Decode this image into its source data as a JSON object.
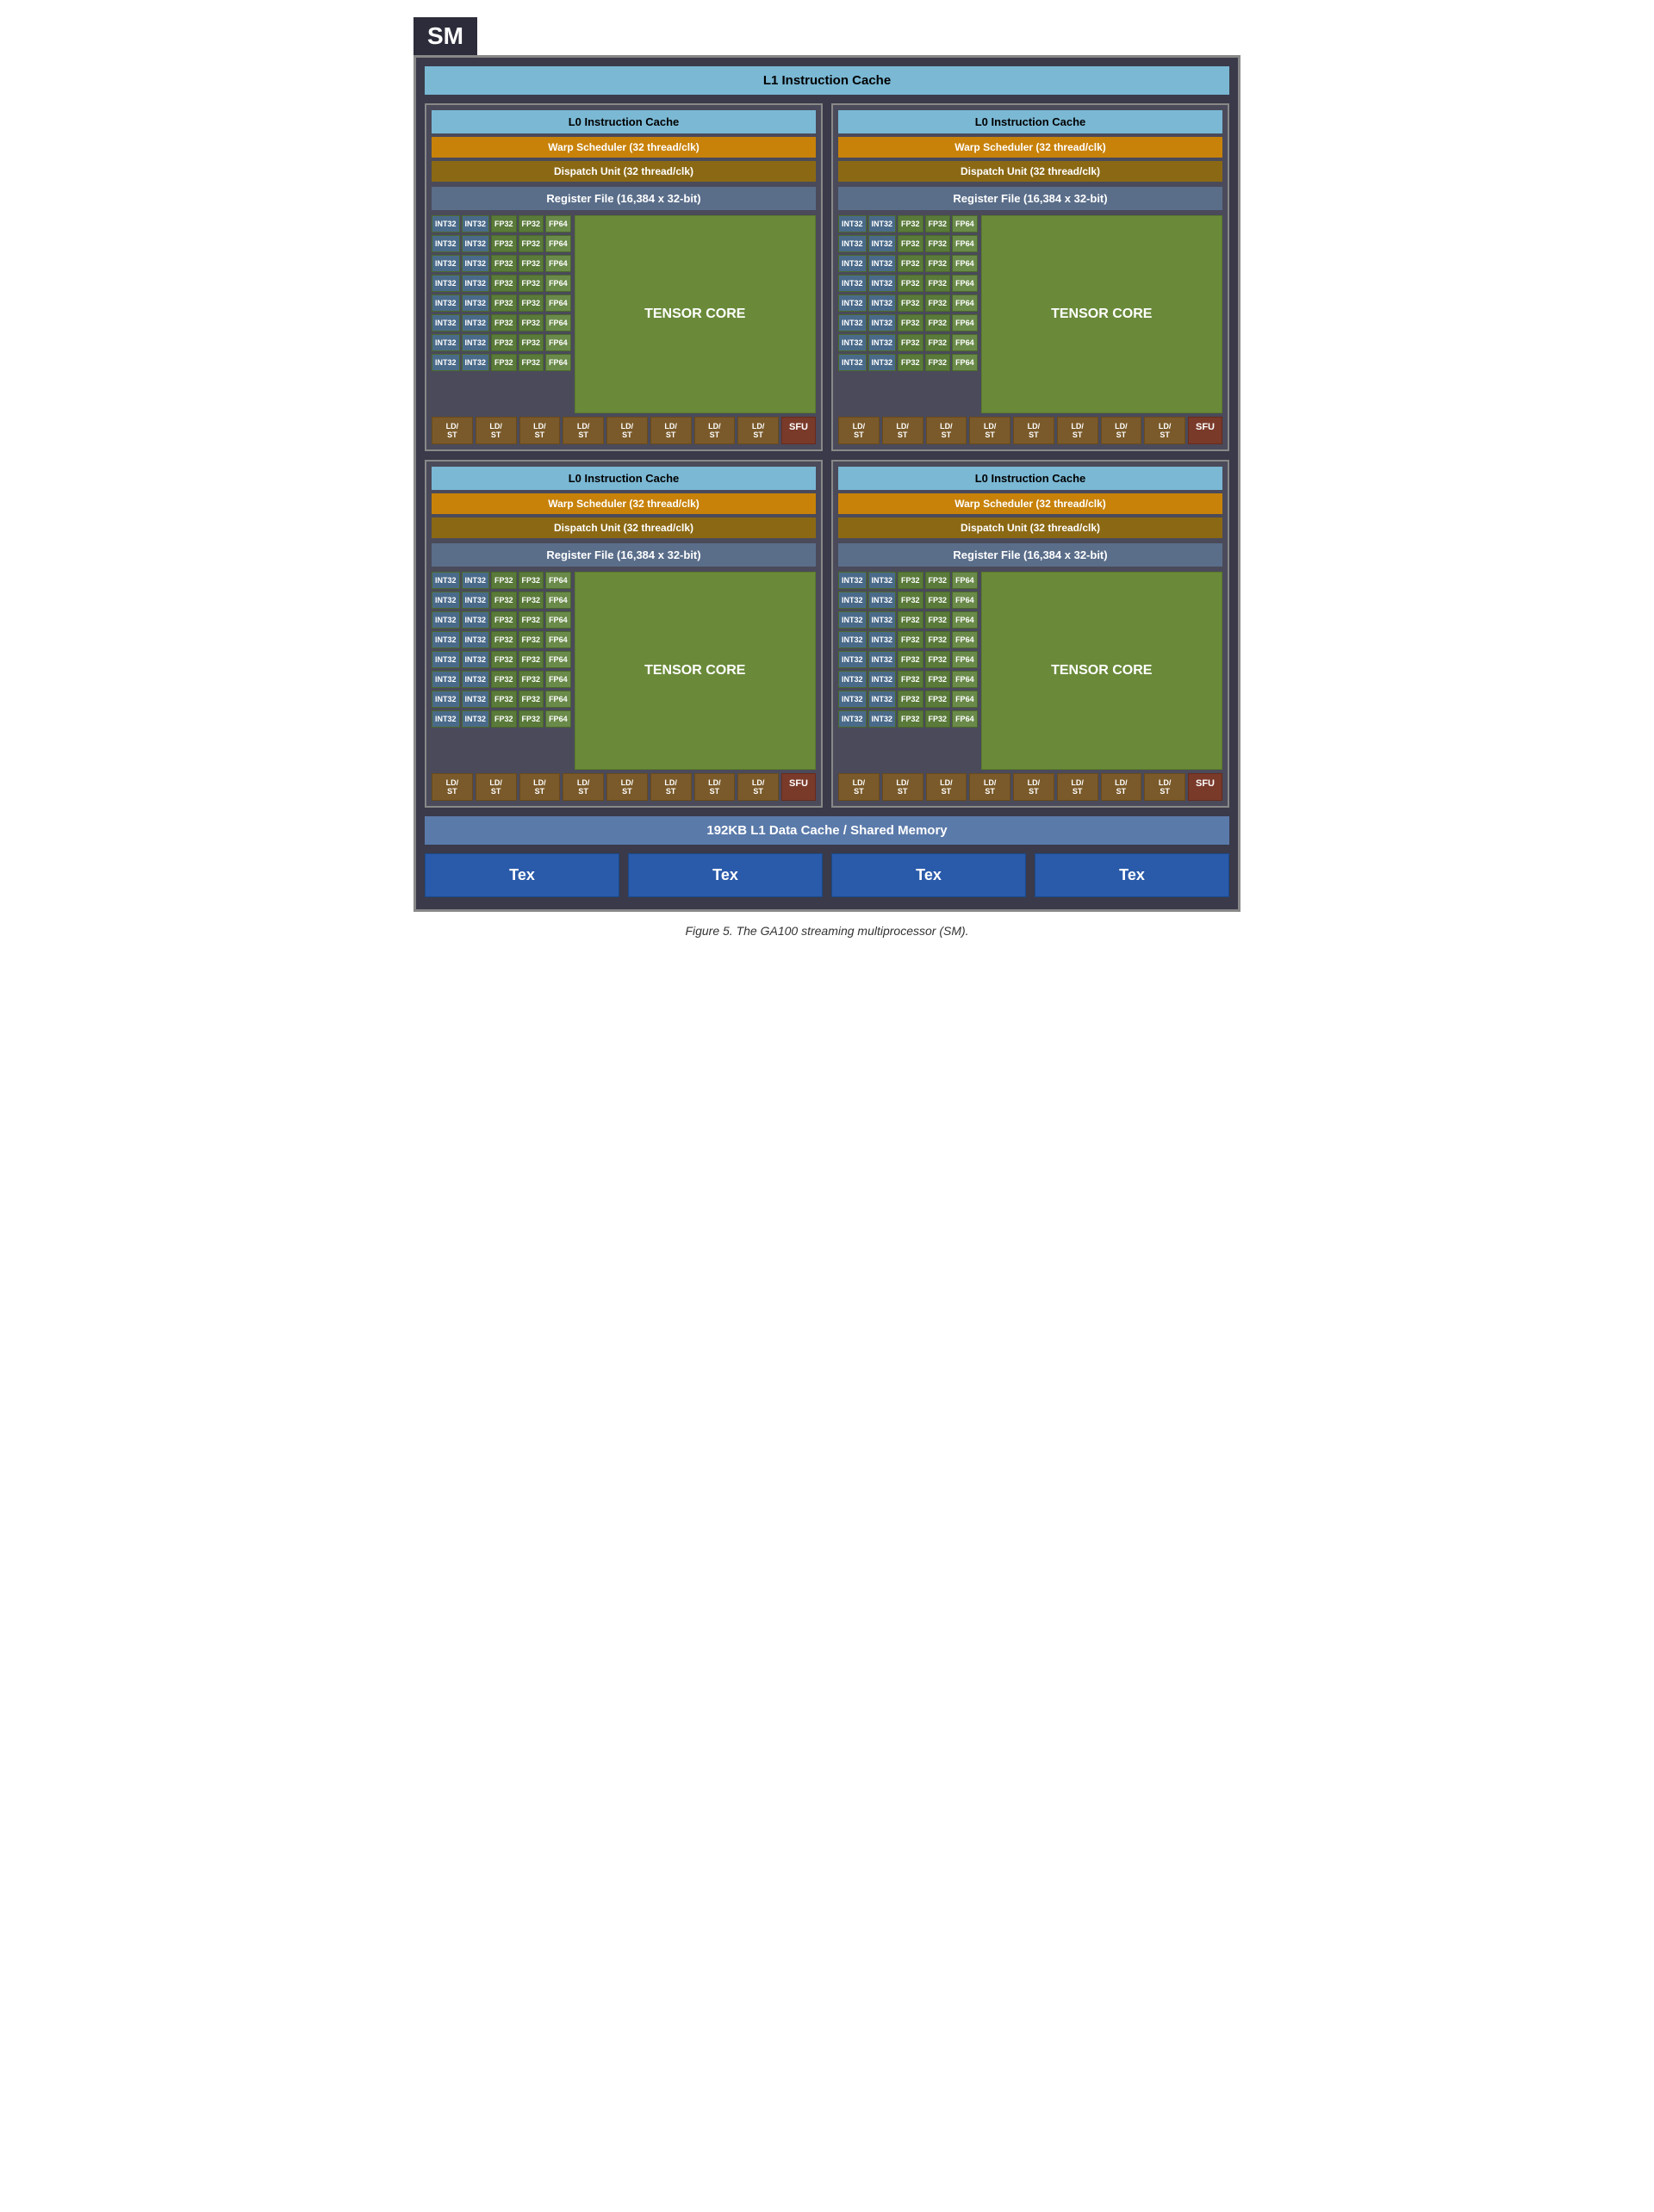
{
  "sm": {
    "label": "SM",
    "l1_instruction_cache": "L1 Instruction Cache",
    "l1_data_cache": "192KB L1 Data Cache / Shared Memory",
    "figure_caption": "Figure 5. The GA100 streaming multiprocessor (SM).",
    "tex_labels": [
      "Tex",
      "Tex",
      "Tex",
      "Tex"
    ],
    "quadrants": [
      {
        "l0_cache": "L0 Instruction Cache",
        "warp_scheduler": "Warp Scheduler (32 thread/clk)",
        "dispatch_unit": "Dispatch Unit (32 thread/clk)",
        "register_file": "Register File (16,384 x 32-bit)",
        "tensor_core": "TENSOR CORE",
        "rows": 8,
        "int32_cols": 2,
        "fp32_cols": 2,
        "fp64_label": "FP64",
        "ld_st_count": 8,
        "ld_st_label": "LD/\nST",
        "sfu_label": "SFU"
      },
      {
        "l0_cache": "L0 Instruction Cache",
        "warp_scheduler": "Warp Scheduler (32 thread/clk)",
        "dispatch_unit": "Dispatch Unit (32 thread/clk)",
        "register_file": "Register File (16,384 x 32-bit)",
        "tensor_core": "TENSOR CORE",
        "rows": 8,
        "int32_cols": 2,
        "fp32_cols": 2,
        "fp64_label": "FP64",
        "ld_st_count": 8,
        "ld_st_label": "LD/\nST",
        "sfu_label": "SFU"
      },
      {
        "l0_cache": "L0 Instruction Cache",
        "warp_scheduler": "Warp Scheduler (32 thread/clk)",
        "dispatch_unit": "Dispatch Unit (32 thread/clk)",
        "register_file": "Register File (16,384 x 32-bit)",
        "tensor_core": "TENSOR CORE",
        "rows": 8,
        "int32_cols": 2,
        "fp32_cols": 2,
        "fp64_label": "FP64",
        "ld_st_count": 8,
        "ld_st_label": "LD/\nST",
        "sfu_label": "SFU"
      },
      {
        "l0_cache": "L0 Instruction Cache",
        "warp_scheduler": "Warp Scheduler (32 thread/clk)",
        "dispatch_unit": "Dispatch Unit (32 thread/clk)",
        "register_file": "Register File (16,384 x 32-bit)",
        "tensor_core": "TENSOR CORE",
        "rows": 8,
        "int32_cols": 2,
        "fp32_cols": 2,
        "fp64_label": "FP64",
        "ld_st_count": 8,
        "ld_st_label": "LD/\nST",
        "sfu_label": "SFU"
      }
    ]
  }
}
